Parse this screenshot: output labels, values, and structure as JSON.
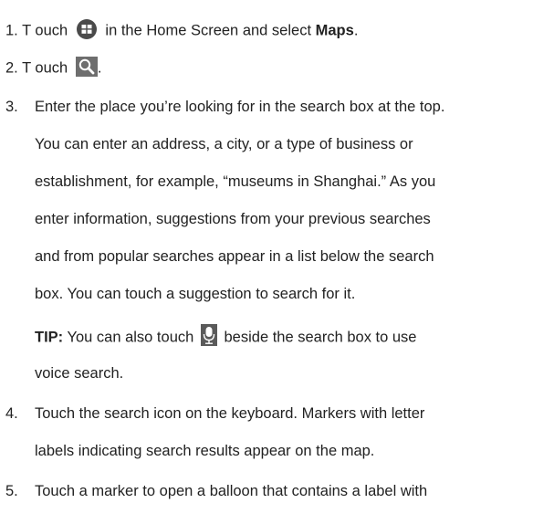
{
  "step1": {
    "num": "1.",
    "pre": "T ouch",
    "post": "in the Home Screen and select",
    "bold": "Maps",
    "end": "."
  },
  "step2": {
    "num": "2.",
    "pre": "T ouch",
    "end": "."
  },
  "step3": {
    "num": "3.",
    "lines": [
      "Enter the place you’re looking for in the search box at the top.",
      "You can enter an address, a city, or a type of business or",
      "establishment, for example, “museums in Shanghai.” As you",
      "enter information, suggestions from your previous searches",
      "and from popular searches appear in a list below the search",
      "box. You can touch a suggestion to search for it."
    ]
  },
  "tip": {
    "label": "TIP:",
    "pre": "You can also touch",
    "post": "beside the search box to use",
    "line2": "voice search."
  },
  "step4": {
    "num": "4.",
    "lines": [
      "Touch the search icon on the keyboard. Markers with letter",
      "labels indicating search results appear on the map."
    ]
  },
  "step5": {
    "num": "5.",
    "lines": [
      "Touch a marker to open a balloon that contains a label with"
    ]
  },
  "icons": {
    "apps": "apps-grid-icon",
    "search": "magnifier-icon",
    "voice": "microphone-icon"
  },
  "colors": {
    "icon_dark": "#4a4a4a",
    "icon_blue": "#3a7bc8"
  }
}
